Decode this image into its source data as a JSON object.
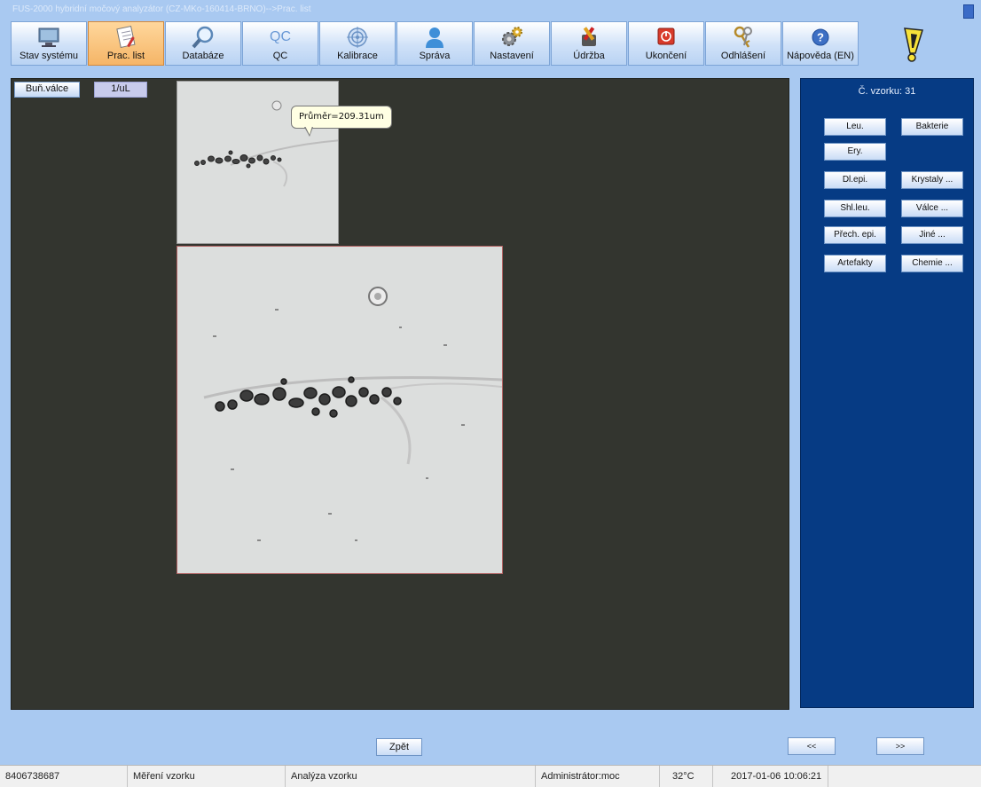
{
  "window": {
    "title": "FUS-2000 hybridní močový analyzátor (CZ-MKo-160414-BRNO)-->Prac. list"
  },
  "toolbar": [
    {
      "label": "Stav systému",
      "icon": "monitor-icon"
    },
    {
      "label": "Prac. list",
      "icon": "notebook-icon",
      "active": true
    },
    {
      "label": "Databáze",
      "icon": "magnifier-icon"
    },
    {
      "label": "QC",
      "icon": "qc-icon"
    },
    {
      "label": "Kalibrace",
      "icon": "target-icon"
    },
    {
      "label": "Správa",
      "icon": "user-icon"
    },
    {
      "label": "Nastavení",
      "icon": "gears-icon"
    },
    {
      "label": "Údržba",
      "icon": "tools-icon"
    },
    {
      "label": "Ukončení",
      "icon": "power-icon"
    },
    {
      "label": "Odhlášení",
      "icon": "keys-icon"
    },
    {
      "label": "Nápověda (EN)",
      "icon": "help-icon"
    }
  ],
  "qc_icon_text": "QC",
  "workspace": {
    "category_tag": "Buň.válce",
    "unit_tag": "1/uL",
    "tooltip": "Průměr=209.31um"
  },
  "sidebar": {
    "sample_label": "Č. vzorku: 31",
    "buttons": {
      "leu": "Leu.",
      "bakterie": "Bakterie",
      "ery": "Ery.",
      "dlepi": "Dl.epi.",
      "krystaly": "Krystaly ...",
      "shlleu": "Shl.leu.",
      "valce": "Válce ...",
      "prechepi": "Přech. epi.",
      "jine": "Jiné ...",
      "artefakty": "Artefakty",
      "chemie": "Chemie ..."
    }
  },
  "bottom": {
    "back": "Zpět",
    "prev": "<<",
    "next": ">>"
  },
  "status": {
    "id": "8406738687",
    "mode": "Měření vzorku",
    "task": "Analýza vzorku",
    "user": "Administrátor:moc",
    "temp": "32°C",
    "datetime": "2017-01-06 10:06:21"
  },
  "colors": {
    "workspace_bg": "#33352f",
    "sidebar_bg": "#063b84",
    "app_bg": "#a9c9f1",
    "active_tab": "#f5b567"
  }
}
